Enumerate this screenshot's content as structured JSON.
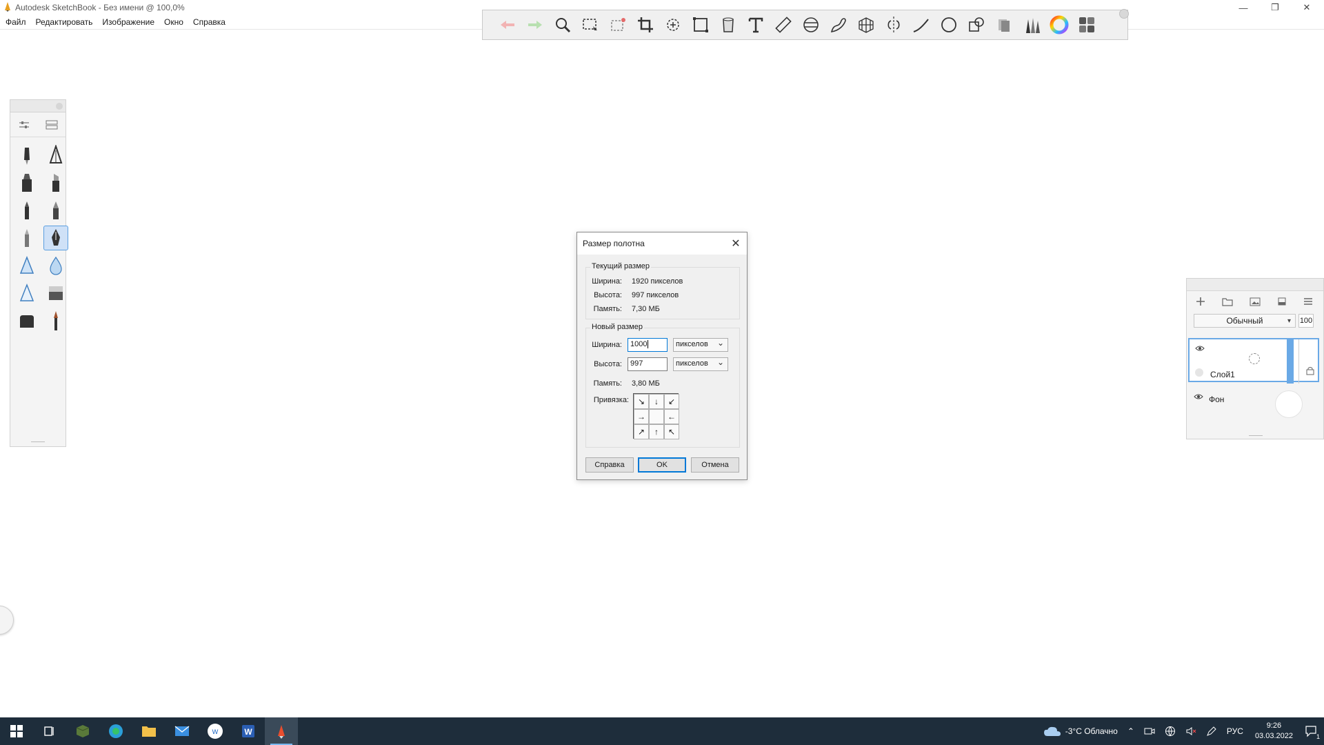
{
  "window": {
    "title": "Autodesk SketchBook - Без имени @ 100,0%",
    "minimize_icon": "minimize-icon",
    "restore_icon": "restore-icon",
    "close_icon": "close-icon"
  },
  "menu": {
    "items": [
      "Файл",
      "Редактировать",
      "Изображение",
      "Окно",
      "Справка"
    ]
  },
  "toolbar": {
    "tools": [
      "undo-icon",
      "redo-icon",
      "zoom-icon",
      "rect-select-icon",
      "lasso-select-icon",
      "crop-icon",
      "transform-icon",
      "distort-icon",
      "fill-icon",
      "text-icon",
      "ruler-icon",
      "ellipse-guide-icon",
      "french-curve-icon",
      "perspective-icon",
      "symmetry-icon",
      "stroke-icon",
      "circle-icon",
      "shapes-icon",
      "copic-icon",
      "brush-library-icon",
      "color-wheel-icon",
      "layout-icon"
    ]
  },
  "brushpanel": {
    "top_icons": [
      "brush-settings-icon",
      "brush-palette-icon"
    ],
    "brushes": [
      "pencil-brush",
      "technical-pen-brush",
      "marker-brush",
      "chisel-marker-brush",
      "ballpoint-brush",
      "fineliner-brush",
      "hard-pencil-brush",
      "ink-pen-brush",
      "airbrush-brush",
      "water-drop-brush",
      "triangle-airbrush-brush",
      "eraser-soft-brush",
      "eraser-hard-brush",
      "paintbrush-brush"
    ],
    "selected_index": 7
  },
  "layers": {
    "blend_mode": "Обычный",
    "opacity": "100",
    "items": [
      {
        "name": "Слой1",
        "selected": true
      },
      {
        "name": "Фон",
        "selected": false
      }
    ]
  },
  "dialog": {
    "title": "Размер полотна",
    "current": {
      "legend": "Текущий размер",
      "width_label": "Ширина:",
      "width_value": "1920 пикселов",
      "height_label": "Высота:",
      "height_value": "997 пикселов",
      "memory_label": "Память:",
      "memory_value": "7,30 МБ"
    },
    "new": {
      "legend": "Новый размер",
      "width_label": "Ширина:",
      "width_value": "1000",
      "width_unit": "пикселов",
      "height_label": "Высота:",
      "height_value": "997",
      "height_unit": "пикселов",
      "memory_label": "Память:",
      "memory_value": "3,80 МБ",
      "anchor_label": "Привязка:"
    },
    "buttons": {
      "help": "Справка",
      "ok": "OK",
      "cancel": "Отмена"
    }
  },
  "taskbar": {
    "apps": [
      "start-icon",
      "task-view-icon",
      "minecraft-icon",
      "edge-icon",
      "explorer-icon",
      "mail-icon",
      "wps-icon",
      "word-icon",
      "sketchbook-icon"
    ],
    "weather": "-3°C Облачно",
    "language": "РУС",
    "time": "9:26",
    "date": "03.03.2022",
    "notification_count": "1"
  },
  "colors": {
    "accent": "#0078d7",
    "taskbar": "#1e2d3b",
    "selection": "#6aa9e6"
  }
}
